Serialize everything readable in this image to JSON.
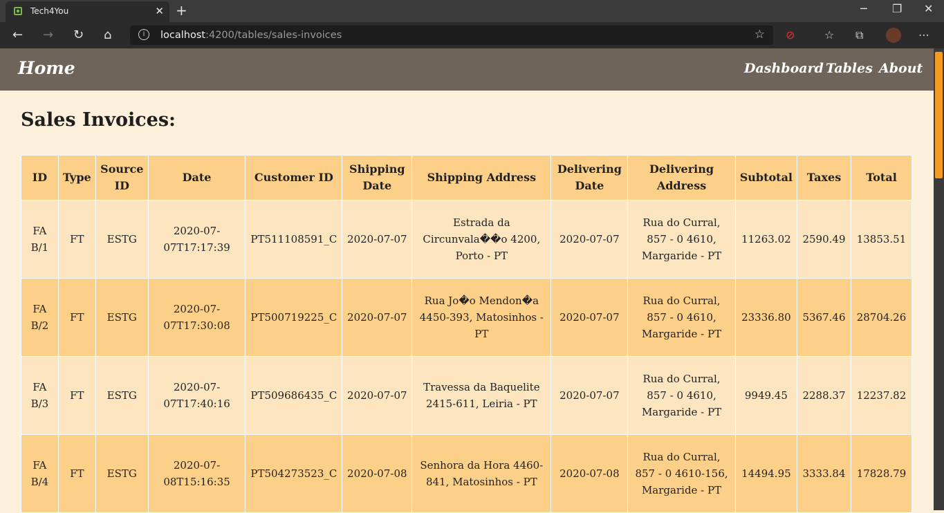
{
  "browser": {
    "tab_title": "Tech4You",
    "tab_close": "✕",
    "new_tab": "+",
    "url_host": "localhost",
    "url_rest": ":4200/tables/sales-invoices"
  },
  "nav": {
    "brand": "Home",
    "links": [
      "Dashboard",
      "Tables",
      "About"
    ]
  },
  "page": {
    "title": "Sales Invoices:"
  },
  "table": {
    "headers": [
      "ID",
      "Type",
      "Source ID",
      "Date",
      "Customer ID",
      "Shipping Date",
      "Shipping Address",
      "Delivering Date",
      "Delivering Address",
      "Subtotal",
      "Taxes",
      "Total"
    ],
    "rows": [
      [
        "FA B/1",
        "FT",
        "ESTG",
        "2020-07-07T17:17:39",
        "PT511108591_C",
        "2020-07-07",
        "Estrada da Circunvala��o 4200, Porto - PT",
        "2020-07-07",
        "Rua do Curral, 857 - 0 4610, Margaride - PT",
        "11263.02",
        "2590.49",
        "13853.51"
      ],
      [
        "FA B/2",
        "FT",
        "ESTG",
        "2020-07-07T17:30:08",
        "PT500719225_C",
        "2020-07-07",
        "Rua Jo�o Mendon�a 4450-393, Matosinhos - PT",
        "2020-07-07",
        "Rua do Curral, 857 - 0 4610, Margaride - PT",
        "23336.80",
        "5367.46",
        "28704.26"
      ],
      [
        "FA B/3",
        "FT",
        "ESTG",
        "2020-07-07T17:40:16",
        "PT509686435_C",
        "2020-07-07",
        "Travessa da Baquelite 2415-611, Leiria - PT",
        "2020-07-07",
        "Rua do Curral, 857 - 0 4610, Margaride - PT",
        "9949.45",
        "2288.37",
        "12237.82"
      ],
      [
        "FA B/4",
        "FT",
        "ESTG",
        "2020-07-08T15:16:35",
        "PT504273523_C",
        "2020-07-08",
        "Senhora da Hora 4460-841, Matosinhos - PT",
        "2020-07-08",
        "Rua do Curral, 857 - 0 4610-156, Margaride - PT",
        "14494.95",
        "3333.84",
        "17828.79"
      ]
    ]
  }
}
